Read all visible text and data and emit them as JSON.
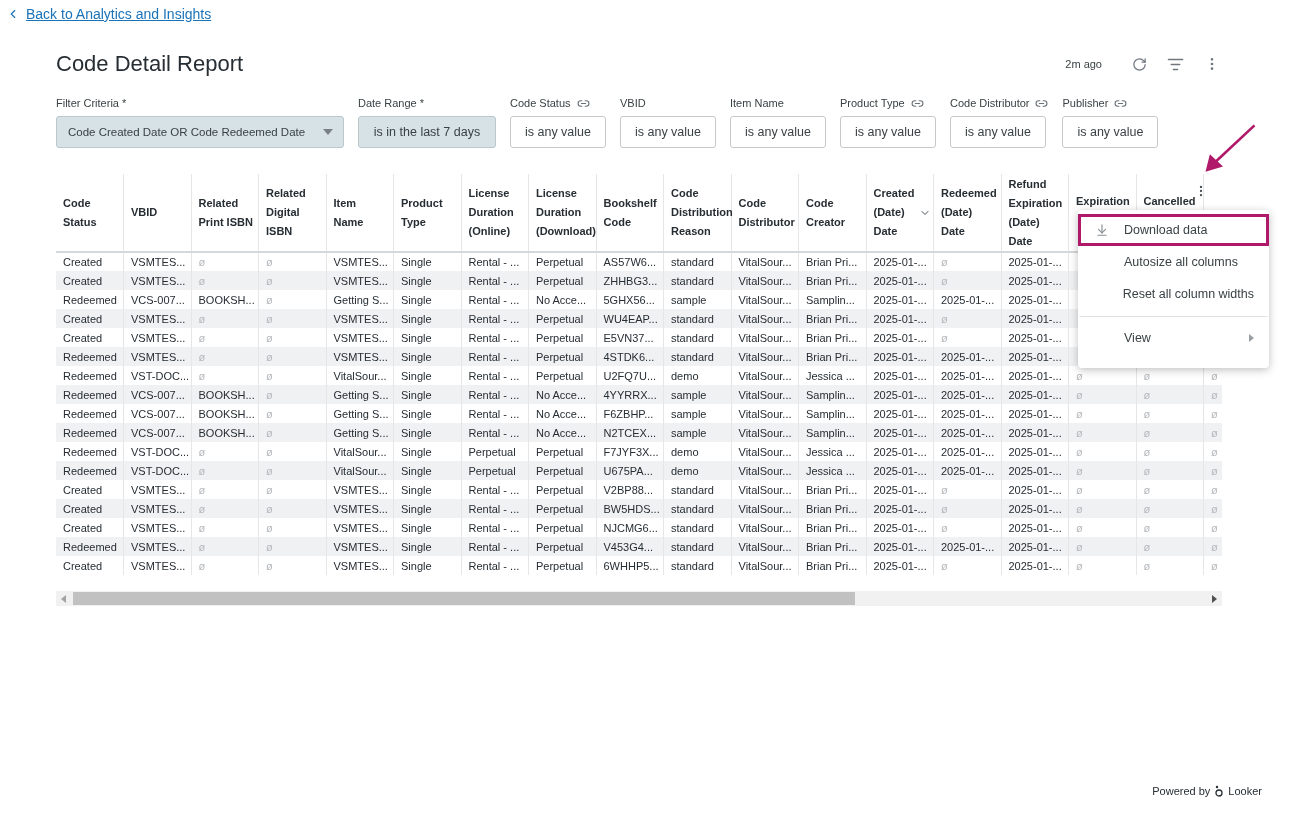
{
  "back_link": "Back to Analytics and Insights",
  "title": "Code Detail Report",
  "updated": "2m ago",
  "filters": [
    {
      "kind": "select",
      "label": "Filter Criteria *",
      "value": "Code Created Date OR Code Redeemed Date",
      "linked": false
    },
    {
      "kind": "date",
      "label": "Date Range *",
      "value": "is in the last 7 days",
      "linked": false
    },
    {
      "kind": "text",
      "label": "Code Status",
      "value": "is any value",
      "linked": true
    },
    {
      "kind": "text",
      "label": "VBID",
      "value": "is any value",
      "linked": false
    },
    {
      "kind": "text",
      "label": "Item Name",
      "value": "is any value",
      "linked": false
    },
    {
      "kind": "text",
      "label": "Product Type",
      "value": "is any value",
      "linked": true
    },
    {
      "kind": "text",
      "label": "Code Distributor",
      "value": "is any value",
      "linked": true
    },
    {
      "kind": "text",
      "label": "Publisher",
      "value": "is any value",
      "linked": true
    }
  ],
  "table": {
    "columns": [
      {
        "label": "Code Status",
        "sorted": false
      },
      {
        "label": "VBID",
        "sorted": false
      },
      {
        "label": "Related Print ISBN",
        "sorted": false
      },
      {
        "label": "Related Digital ISBN",
        "sorted": false
      },
      {
        "label": "Item Name",
        "sorted": false
      },
      {
        "label": "Product Type",
        "sorted": false
      },
      {
        "label": "License Duration (Online)",
        "sorted": false
      },
      {
        "label": "License Duration (Download)",
        "sorted": false
      },
      {
        "label": "Bookshelf Code",
        "sorted": false
      },
      {
        "label": "Code Distribution Reason",
        "sorted": false
      },
      {
        "label": "Code Distributor",
        "sorted": false
      },
      {
        "label": "Code Creator",
        "sorted": false
      },
      {
        "label": "Created (Date) Date",
        "sorted": true
      },
      {
        "label": "Redeemed (Date) Date",
        "sorted": false
      },
      {
        "label": "Refund Expiration (Date) Date",
        "sorted": false
      },
      {
        "label": "Expiration",
        "sorted": false
      },
      {
        "label": "Cancelled",
        "sorted": false
      },
      {
        "sorted": false
      }
    ],
    "rows": [
      [
        "Created",
        "VSMTES...",
        {
          "empty": "ø"
        },
        {
          "empty": "ø"
        },
        "VSMTES...",
        "Single",
        "Rental - ...",
        "Perpetual",
        "AS57W6...",
        "standard",
        "VitalSour...",
        "Brian Pri...",
        "2025-01-...",
        {
          "empty": "ø"
        },
        "2025-01-..."
      ],
      [
        "Created",
        "VSMTES...",
        {
          "empty": "ø"
        },
        {
          "empty": "ø"
        },
        "VSMTES...",
        "Single",
        "Rental - ...",
        "Perpetual",
        "ZHHBG3...",
        "standard",
        "VitalSour...",
        "Brian Pri...",
        "2025-01-...",
        {
          "empty": "ø"
        },
        "2025-01-..."
      ],
      [
        "Redeemed",
        "VCS-007...",
        "BOOKSH...",
        {
          "empty": "ø"
        },
        "Getting S...",
        "Single",
        "Rental - ...",
        "No Acce...",
        "5GHX56...",
        "sample",
        "VitalSour...",
        "Samplin...",
        "2025-01-...",
        "2025-01-...",
        "2025-01-..."
      ],
      [
        "Created",
        "VSMTES...",
        {
          "empty": "ø"
        },
        {
          "empty": "ø"
        },
        "VSMTES...",
        "Single",
        "Rental - ...",
        "Perpetual",
        "WU4EAP...",
        "standard",
        "VitalSour...",
        "Brian Pri...",
        "2025-01-...",
        {
          "empty": "ø"
        },
        "2025-01-..."
      ],
      [
        "Created",
        "VSMTES...",
        {
          "empty": "ø"
        },
        {
          "empty": "ø"
        },
        "VSMTES...",
        "Single",
        "Rental - ...",
        "Perpetual",
        "E5VN37...",
        "standard",
        "VitalSour...",
        "Brian Pri...",
        "2025-01-...",
        {
          "empty": "ø"
        },
        "2025-01-..."
      ],
      [
        "Redeemed",
        "VSMTES...",
        {
          "empty": "ø"
        },
        {
          "empty": "ø"
        },
        "VSMTES...",
        "Single",
        "Rental - ...",
        "Perpetual",
        "4STDK6...",
        "standard",
        "VitalSour...",
        "Brian Pri...",
        "2025-01-...",
        "2025-01-...",
        "2025-01-..."
      ],
      [
        "Redeemed",
        "VST-DOC...",
        {
          "empty": "ø"
        },
        {
          "empty": "ø"
        },
        "VitalSour...",
        "Single",
        "Rental - ...",
        "Perpetual",
        "U2FQ7U...",
        "demo",
        "VitalSour...",
        "Jessica ...",
        "2025-01-...",
        "2025-01-...",
        "2025-01-...",
        {
          "empty": "ø"
        },
        {
          "empty": "ø"
        },
        {
          "empty": "ø"
        }
      ],
      [
        "Redeemed",
        "VCS-007...",
        "BOOKSH...",
        {
          "empty": "ø"
        },
        "Getting S...",
        "Single",
        "Rental - ...",
        "No Acce...",
        "4YYRRX...",
        "sample",
        "VitalSour...",
        "Samplin...",
        "2025-01-...",
        "2025-01-...",
        "2025-01-...",
        {
          "empty": "ø"
        },
        {
          "empty": "ø"
        },
        {
          "empty": "ø"
        }
      ],
      [
        "Redeemed",
        "VCS-007...",
        "BOOKSH...",
        {
          "empty": "ø"
        },
        "Getting S...",
        "Single",
        "Rental - ...",
        "No Acce...",
        "F6ZBHP...",
        "sample",
        "VitalSour...",
        "Samplin...",
        "2025-01-...",
        "2025-01-...",
        "2025-01-...",
        {
          "empty": "ø"
        },
        {
          "empty": "ø"
        },
        {
          "empty": "ø"
        }
      ],
      [
        "Redeemed",
        "VCS-007...",
        "BOOKSH...",
        {
          "empty": "ø"
        },
        "Getting S...",
        "Single",
        "Rental - ...",
        "No Acce...",
        "N2TCEX...",
        "sample",
        "VitalSour...",
        "Samplin...",
        "2025-01-...",
        "2025-01-...",
        "2025-01-...",
        {
          "empty": "ø"
        },
        {
          "empty": "ø"
        },
        {
          "empty": "ø"
        }
      ],
      [
        "Redeemed",
        "VST-DOC...",
        {
          "empty": "ø"
        },
        {
          "empty": "ø"
        },
        "VitalSour...",
        "Single",
        "Perpetual",
        "Perpetual",
        "F7JYF3X...",
        "demo",
        "VitalSour...",
        "Jessica ...",
        "2025-01-...",
        "2025-01-...",
        "2025-01-...",
        {
          "empty": "ø"
        },
        {
          "empty": "ø"
        },
        {
          "empty": "ø"
        }
      ],
      [
        "Redeemed",
        "VST-DOC...",
        {
          "empty": "ø"
        },
        {
          "empty": "ø"
        },
        "VitalSour...",
        "Single",
        "Perpetual",
        "Perpetual",
        "U675PA...",
        "demo",
        "VitalSour...",
        "Jessica ...",
        "2025-01-...",
        "2025-01-...",
        "2025-01-...",
        {
          "empty": "ø"
        },
        {
          "empty": "ø"
        },
        {
          "empty": "ø"
        }
      ],
      [
        "Created",
        "VSMTES...",
        {
          "empty": "ø"
        },
        {
          "empty": "ø"
        },
        "VSMTES...",
        "Single",
        "Rental - ...",
        "Perpetual",
        "V2BP88...",
        "standard",
        "VitalSour...",
        "Brian Pri...",
        "2025-01-...",
        {
          "empty": "ø"
        },
        "2025-01-...",
        {
          "empty": "ø"
        },
        {
          "empty": "ø"
        },
        {
          "empty": "ø"
        }
      ],
      [
        "Created",
        "VSMTES...",
        {
          "empty": "ø"
        },
        {
          "empty": "ø"
        },
        "VSMTES...",
        "Single",
        "Rental - ...",
        "Perpetual",
        "BW5HDS...",
        "standard",
        "VitalSour...",
        "Brian Pri...",
        "2025-01-...",
        {
          "empty": "ø"
        },
        "2025-01-...",
        {
          "empty": "ø"
        },
        {
          "empty": "ø"
        },
        {
          "empty": "ø"
        }
      ],
      [
        "Created",
        "VSMTES...",
        {
          "empty": "ø"
        },
        {
          "empty": "ø"
        },
        "VSMTES...",
        "Single",
        "Rental - ...",
        "Perpetual",
        "NJCMG6...",
        "standard",
        "VitalSour...",
        "Brian Pri...",
        "2025-01-...",
        {
          "empty": "ø"
        },
        "2025-01-...",
        {
          "empty": "ø"
        },
        {
          "empty": "ø"
        },
        {
          "empty": "ø"
        }
      ],
      [
        "Redeemed",
        "VSMTES...",
        {
          "empty": "ø"
        },
        {
          "empty": "ø"
        },
        "VSMTES...",
        "Single",
        "Rental - ...",
        "Perpetual",
        "V453G4...",
        "standard",
        "VitalSour...",
        "Brian Pri...",
        "2025-01-...",
        "2025-01-...",
        "2025-01-...",
        {
          "empty": "ø"
        },
        {
          "empty": "ø"
        },
        {
          "empty": "ø"
        }
      ],
      [
        "Created",
        "VSMTES...",
        {
          "empty": "ø"
        },
        {
          "empty": "ø"
        },
        "VSMTES...",
        "Single",
        "Rental - ...",
        "Perpetual",
        "6WHHP5...",
        "standard",
        "VitalSour...",
        "Brian Pri...",
        "2025-01-...",
        {
          "empty": "ø"
        },
        "2025-01-...",
        {
          "empty": "ø"
        },
        {
          "empty": "ø"
        },
        {
          "empty": "ø"
        }
      ]
    ]
  },
  "menu": [
    {
      "kind": "download",
      "label": "Download data",
      "highlighted": true
    },
    {
      "kind": "item",
      "label": "Autosize all columns",
      "highlighted": false
    },
    {
      "kind": "item",
      "label": "Reset all column widths",
      "highlighted": false
    },
    {
      "kind": "submenu",
      "label": "View",
      "highlighted": false
    }
  ],
  "footer": {
    "prefix": "Powered by",
    "brand": "Looker"
  }
}
